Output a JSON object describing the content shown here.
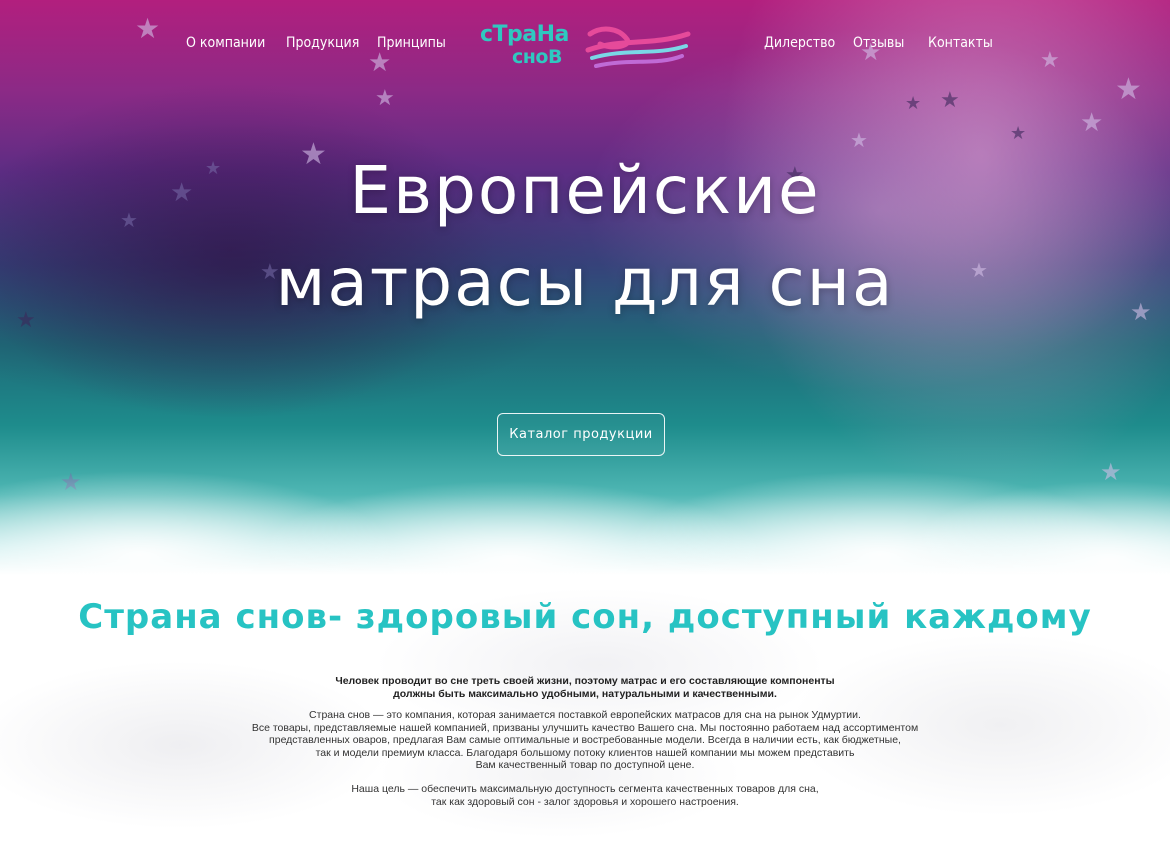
{
  "nav": {
    "left": [
      {
        "label": "О компании"
      },
      {
        "label": "Продукция"
      },
      {
        "label": "Принципы"
      }
    ],
    "right": [
      {
        "label": "Дилерство"
      },
      {
        "label": "Отзывы"
      },
      {
        "label": "Контакты"
      }
    ]
  },
  "logo": {
    "line1": "сТраНа",
    "line2": "снoВ"
  },
  "hero": {
    "title_line1": "Европейские",
    "title_line2": "матрасы для сна",
    "button_label": "Каталог продукции"
  },
  "about": {
    "title": "Страна снов- здоровый сон, доступный каждому",
    "intro_lines": [
      "Человек проводит во сне треть своей жизни, поэтому матрас и его составляющие компоненты",
      "должны быть максимально удобными, натуральными и качественными."
    ],
    "para1_lines": [
      "Страна снов — это компания, которая занимается поставкой европейских матрасов для сна на рынок Удмуртии.",
      "Все товары, представляемые нашей компанией, призваны улучшить качество Вашего сна. Мы постоянно работаем над ассортиментом",
      "представленных оваров, предлагая Вам самые оптимальные и востребованные модели. Всегда в наличии есть, как бюджетные,",
      "так и модели премиум класса.  Благодаря большому потоку клиентов нашей компании мы можем представить",
      "Вам качественный товар по доступной цене."
    ],
    "para2_lines": [
      "Наша цель — обеспечить максимальную доступность сегмента качественных товаров для сна,",
      "так как здоровый сон - залог здоровья и хорошего настроения."
    ]
  },
  "colors": {
    "accent": "#27c3c3",
    "logo_pink": "#e64a9a",
    "hero_top": "#b21f7e",
    "hero_mid": "#36427a",
    "hero_bottom": "#1e8c8c"
  }
}
